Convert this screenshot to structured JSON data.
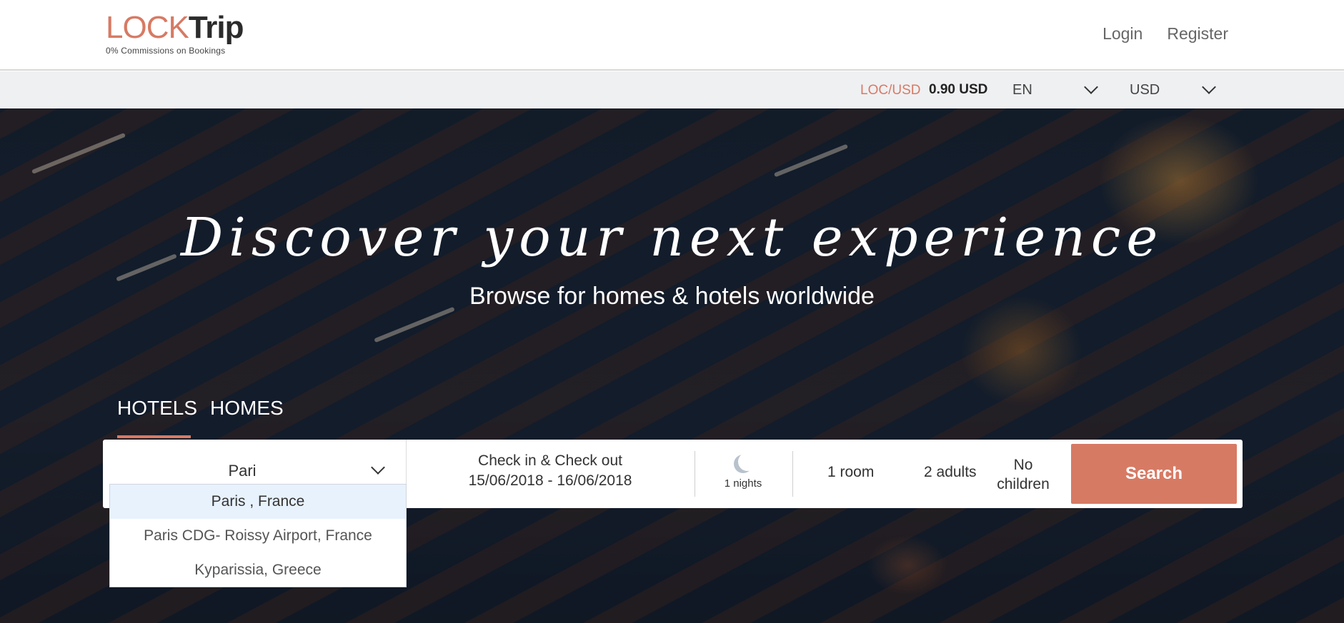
{
  "header": {
    "logo_lock": "LOCK",
    "logo_trip": "Trip",
    "tagline": "0% Commissions on Bookings",
    "login": "Login",
    "register": "Register"
  },
  "subbar": {
    "rate_label": "LOC/USD",
    "rate_value": "0.90 USD",
    "language": "EN",
    "currency": "USD"
  },
  "hero": {
    "title": "Discover your next experience",
    "subtitle": "Browse for homes & hotels worldwide"
  },
  "tabs": [
    {
      "label": "HOTELS",
      "active": true
    },
    {
      "label": "HOMES",
      "active": false
    }
  ],
  "search": {
    "destination_value": "Pari",
    "dates_label": "Check in & Check out",
    "dates_value": "15/06/2018 - 16/06/2018",
    "nights": "1 nights",
    "rooms": "1 room",
    "adults": "2 adults",
    "children_line1": "No",
    "children_line2": "children",
    "button": "Search"
  },
  "suggestions": [
    {
      "label": "Paris , France",
      "highlighted": true
    },
    {
      "label": "Paris CDG- Roissy Airport, France",
      "highlighted": false
    },
    {
      "label": "Kyparissia, Greece",
      "highlighted": false
    }
  ],
  "colors": {
    "accent": "#d77a64",
    "subbar_bg": "#eff0f2",
    "suggestion_highlight": "#e8f2fd"
  },
  "icons": {
    "nights": "moon-icon",
    "dropdown": "chevron-down-icon"
  }
}
